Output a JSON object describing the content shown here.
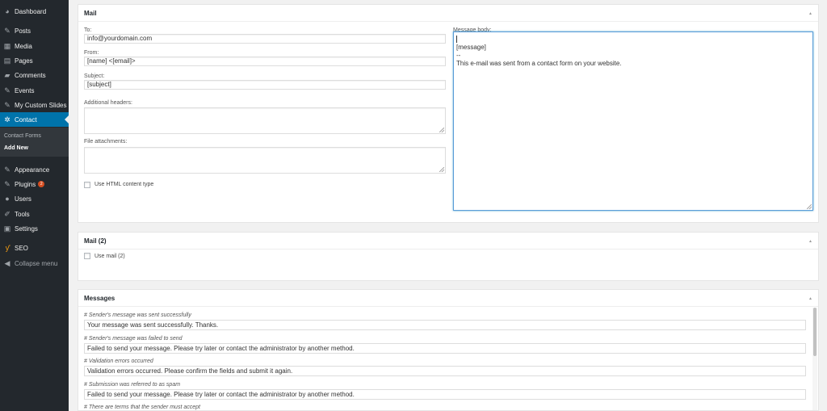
{
  "sidebar": {
    "items": [
      {
        "label": "Dashboard",
        "icon": "dashboard-icon",
        "glyph": "◕"
      },
      {
        "label": "Posts",
        "icon": "pin-icon",
        "glyph": "✎"
      },
      {
        "label": "Media",
        "icon": "media-icon",
        "glyph": "▦"
      },
      {
        "label": "Pages",
        "icon": "pages-icon",
        "glyph": "▤"
      },
      {
        "label": "Comments",
        "icon": "comments-icon",
        "glyph": "▰"
      },
      {
        "label": "Events",
        "icon": "pin-icon",
        "glyph": "✎"
      },
      {
        "label": "My Custom Slides",
        "icon": "pin-icon",
        "glyph": "✎"
      },
      {
        "label": "Contact",
        "icon": "gear-icon",
        "glyph": "✲"
      },
      {
        "label": "Appearance",
        "icon": "brush-icon",
        "glyph": "✎"
      },
      {
        "label": "Plugins",
        "icon": "plug-icon",
        "glyph": "✎",
        "badge": "2"
      },
      {
        "label": "Users",
        "icon": "users-icon",
        "glyph": "●"
      },
      {
        "label": "Tools",
        "icon": "wrench-icon",
        "glyph": "✐"
      },
      {
        "label": "Settings",
        "icon": "settings-icon",
        "glyph": "▣"
      },
      {
        "label": "SEO",
        "icon": "seo-icon",
        "glyph": "ƴ"
      },
      {
        "label": "Collapse menu",
        "icon": "collapse-icon",
        "glyph": "◀"
      }
    ],
    "submenu": [
      "Contact Forms",
      "Add New"
    ]
  },
  "mail": {
    "title": "Mail",
    "toggle": "▲",
    "to_label": "To:",
    "to_value": "info@yourdomain.com",
    "from_label": "From:",
    "from_value": "[name] <[email]>",
    "subject_label": "Subject:",
    "subject_value": "[subject]",
    "headers_label": "Additional headers:",
    "attachments_label": "File attachments:",
    "html_label": "Use HTML content type",
    "body_label": "Message body:",
    "body_lines": [
      "[message]",
      "--",
      "This e-mail was sent from a contact form on your website."
    ]
  },
  "mail2": {
    "title": "Mail (2)",
    "toggle": "▲",
    "use_label": "Use mail (2)"
  },
  "messages": {
    "title": "Messages",
    "toggle": "▲",
    "items": [
      {
        "desc": "# Sender's message was sent successfully",
        "value": "Your message was sent successfully. Thanks."
      },
      {
        "desc": "# Sender's message was failed to send",
        "value": "Failed to send your message. Please try later or contact the administrator by another method."
      },
      {
        "desc": "# Validation errors occurred",
        "value": "Validation errors occurred. Please confirm the fields and submit it again."
      },
      {
        "desc": "# Submission was referred to as spam",
        "value": "Failed to send your message. Please try later or contact the administrator by another method."
      },
      {
        "desc": "# There are terms that the sender must accept",
        "value": ""
      }
    ]
  },
  "colors": {
    "sidebar": "#23282d",
    "active": "#0073aa",
    "badge": "#d54e21"
  }
}
